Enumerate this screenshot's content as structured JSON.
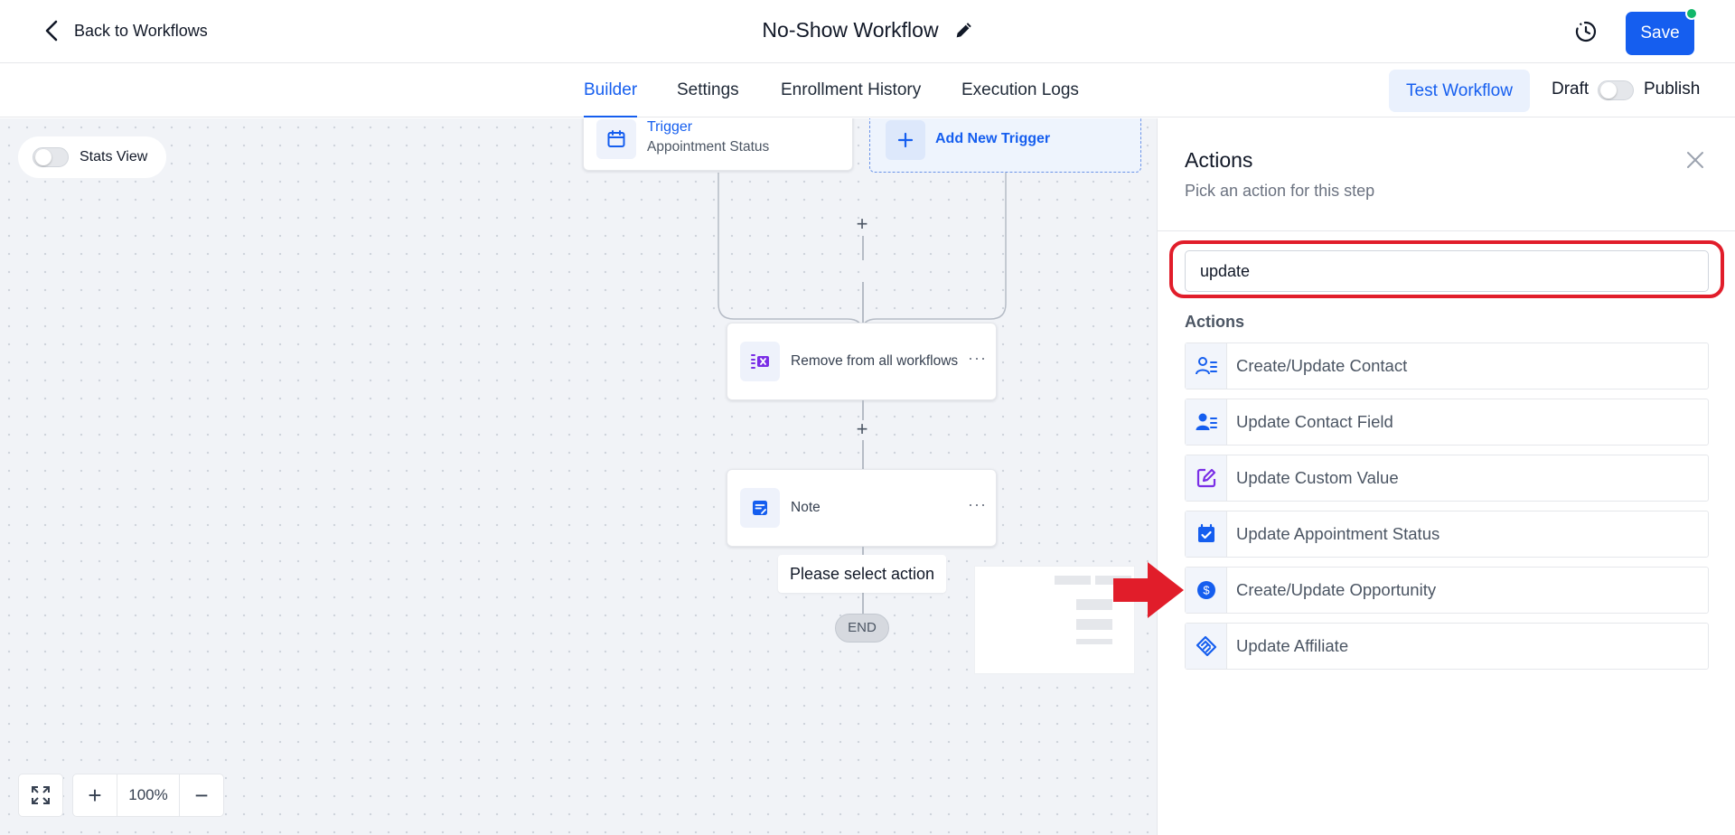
{
  "header": {
    "back_label": "Back to Workflows",
    "title": "No-Show Workflow",
    "save_label": "Save",
    "accent": "#155eef",
    "status_dot_color": "#12b76a"
  },
  "tabs": {
    "items": [
      "Builder",
      "Settings",
      "Enrollment History",
      "Execution Logs"
    ],
    "active": "Builder",
    "test_workflow": "Test Workflow",
    "draft": "Draft",
    "publish": "Publish"
  },
  "canvas": {
    "stats_view": "Stats View",
    "trigger": {
      "title": "Trigger",
      "subtitle": "Appointment Status"
    },
    "add_trigger": "Add New Trigger",
    "steps": [
      {
        "label": "Remove from all workflows",
        "icon": "remove-workflow-icon"
      },
      {
        "label": "Note",
        "icon": "note-icon"
      }
    ],
    "select_tip": "Please select action",
    "end_label": "END",
    "zoom": "100%"
  },
  "panel": {
    "title": "Actions",
    "subtitle": "Pick an action for this step",
    "search_value": "update",
    "section_label": "Actions",
    "items": [
      {
        "label": "Create/Update Contact",
        "icon": "contact-list-icon"
      },
      {
        "label": "Update Contact Field",
        "icon": "contact-field-icon"
      },
      {
        "label": "Update Custom Value",
        "icon": "edit-square-icon"
      },
      {
        "label": "Update Appointment Status",
        "icon": "calendar-check-icon"
      },
      {
        "label": "Create/Update Opportunity",
        "icon": "dollar-circle-icon"
      },
      {
        "label": "Update Affiliate",
        "icon": "handshake-icon"
      }
    ],
    "highlight_color": "#e11d2a"
  }
}
